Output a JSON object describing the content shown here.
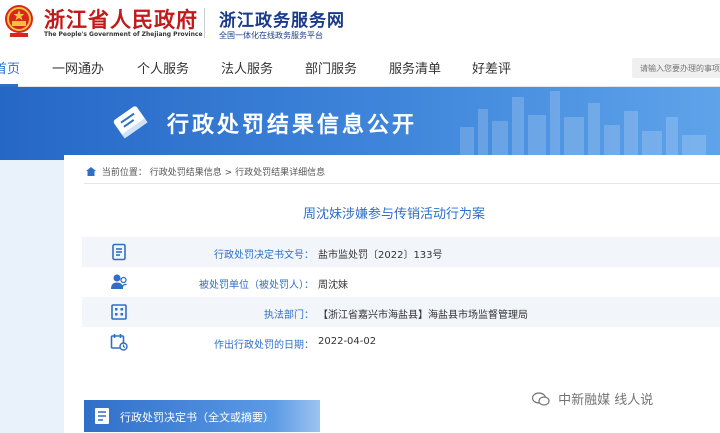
{
  "header": {
    "site_name": "浙江省人民政府",
    "site_name_en": "The People's Government of Zhejiang Province",
    "service_name": "浙江政务服务网",
    "service_subtitle": "全国一体化在线政务服务平台"
  },
  "nav": {
    "items": [
      {
        "label": "首页",
        "active": true
      },
      {
        "label": "一网通办"
      },
      {
        "label": "个人服务"
      },
      {
        "label": "法人服务"
      },
      {
        "label": "部门服务"
      },
      {
        "label": "服务清单"
      },
      {
        "label": "好差评"
      }
    ],
    "search_placeholder": "请输入您要办理的事项"
  },
  "banner": {
    "title": "行政处罚结果信息公开",
    "icon": "book-icon"
  },
  "breadcrumb": {
    "prefix": "当前位置：",
    "items": [
      "行政处罚结果信息",
      "行政处罚结果详细信息"
    ],
    "separator": ">"
  },
  "case_title": "周沈妹涉嫌参与传销活动行为案",
  "info_rows": [
    {
      "icon": "document-number-icon",
      "label": "行政处罚决定书文号：",
      "value": "盐市监处罚〔2022〕133号"
    },
    {
      "icon": "person-icon",
      "label": "被处罚单位（被处罚人）：",
      "value": "周沈妹"
    },
    {
      "icon": "building-icon",
      "label": "执法部门：",
      "value": "【浙江省嘉兴市海盐县】海盐县市场监督管理局"
    },
    {
      "icon": "calendar-icon",
      "label": "作出行政处罚的日期：",
      "value": "2022-04-02"
    }
  ],
  "doc_section": {
    "title": "行政处罚决定书（全文或摘要）",
    "icon": "file-icon"
  },
  "watermark": "中新融媒 线人说",
  "colors": {
    "accent": "#2f6fc8",
    "brand_red": "#c21a1a",
    "banner_blue": "#2667c6"
  }
}
